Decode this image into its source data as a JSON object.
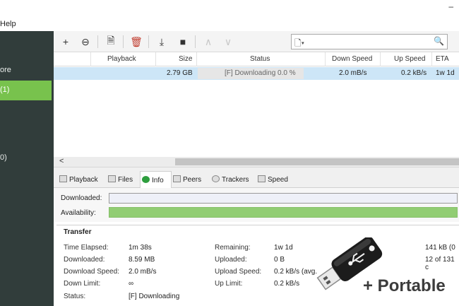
{
  "window": {
    "minimize_glyph": "–"
  },
  "menubar": {
    "items": [
      "Help"
    ]
  },
  "sidebar": {
    "items": [
      {
        "label": "ore",
        "active": false
      },
      {
        "label": "(1)",
        "active": true
      },
      {
        "label": "0)",
        "active": false
      }
    ]
  },
  "toolbar": {
    "buttons": [
      {
        "name": "add-torrent-button",
        "icon": "+"
      },
      {
        "name": "add-link-button",
        "icon": "⊖"
      },
      {
        "name": "create-torrent-button",
        "icon": "🗎"
      },
      {
        "name": "delete-button",
        "icon": "🗑"
      },
      {
        "name": "resume-button",
        "icon": "⤓"
      },
      {
        "name": "pause-button",
        "icon": "■"
      },
      {
        "name": "move-up-button",
        "icon": "∧"
      },
      {
        "name": "move-down-button",
        "icon": "∨"
      }
    ],
    "search": {
      "filter_icon": "🗋▾",
      "placeholder": "",
      "icon": "🔍"
    }
  },
  "torrent_list": {
    "columns": [
      "Playback",
      "Size",
      "Status",
      "Down Speed",
      "Up Speed",
      "ETA"
    ],
    "rows": [
      {
        "playback": "",
        "size": "2.79 GB",
        "status": "[F] Downloading 0.0 %",
        "down_speed": "2.0 mB/s",
        "up_speed": "0.2 kB/s",
        "eta": "1w 1d",
        "progress": 0.0
      }
    ]
  },
  "scrollbar": {
    "left_arrow": "<"
  },
  "detail_tabs": [
    {
      "label": "Playback",
      "active": false
    },
    {
      "label": "Files",
      "active": false
    },
    {
      "label": "Info",
      "active": true
    },
    {
      "label": "Peers",
      "active": false
    },
    {
      "label": "Trackers",
      "active": false
    },
    {
      "label": "Speed",
      "active": false
    }
  ],
  "bars": {
    "downloaded_label": "Downloaded:",
    "availability_label": "Availability:",
    "downloaded_fraction": 0.0,
    "availability_fraction": 1.0
  },
  "transfer": {
    "title": "Transfer",
    "left": [
      {
        "label": "Time Elapsed:",
        "value": "1m 38s"
      },
      {
        "label": "Downloaded:",
        "value": "8.59 MB"
      },
      {
        "label": "Download Speed:",
        "value": "2.0 mB/s"
      },
      {
        "label": "Down Limit:",
        "value": "∞"
      },
      {
        "label": "Status:",
        "value": "[F] Downloading"
      }
    ],
    "middle": [
      {
        "label": "Remaining:",
        "value": "1w 1d"
      },
      {
        "label": "Uploaded:",
        "value": "0 B"
      },
      {
        "label": "Upload Speed:",
        "value": "0.2 kB/s (avg."
      },
      {
        "label": "Up Limit:",
        "value": "0.2 kB/s"
      }
    ],
    "right": [
      {
        "value": "141 kB (0"
      },
      {
        "value": "12 of 131 c"
      }
    ]
  },
  "overlay": {
    "portable_text": "+ Portable",
    "usb_icon": "usb-drive-icon"
  }
}
